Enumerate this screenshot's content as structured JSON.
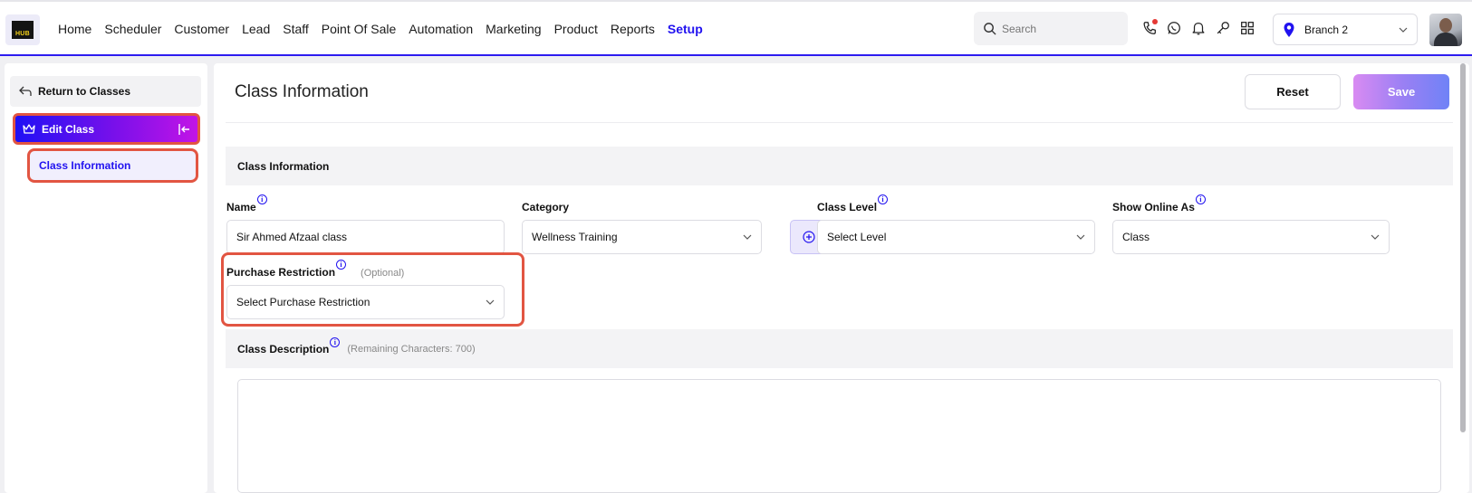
{
  "logo": {
    "text": "HUB"
  },
  "nav": {
    "items": [
      "Home",
      "Scheduler",
      "Customer",
      "Lead",
      "Staff",
      "Point Of Sale",
      "Automation",
      "Marketing",
      "Product",
      "Reports",
      "Setup"
    ],
    "active": "Setup"
  },
  "search": {
    "placeholder": "Search"
  },
  "header_icons": [
    "phone-icon",
    "whatsapp-icon",
    "bell-icon",
    "key-icon",
    "grid-icon"
  ],
  "branch": {
    "label": "Branch 2"
  },
  "sidebar": {
    "return_label": "Return to Classes",
    "section_label": "Edit Class",
    "item_label": "Class Information"
  },
  "main": {
    "title": "Class Information",
    "reset_label": "Reset",
    "save_label": "Save",
    "section_title": "Class Information",
    "fields": {
      "name": {
        "label": "Name",
        "value": "Sir Ahmed Afzaal class"
      },
      "category": {
        "label": "Category",
        "value": "Wellness Training"
      },
      "class_level": {
        "label": "Class Level",
        "value": "Select Level"
      },
      "show_online_as": {
        "label": "Show Online As",
        "value": "Class"
      },
      "purchase_restriction": {
        "label": "Purchase Restriction",
        "optional": "(Optional)",
        "value": "Select Purchase Restriction"
      }
    },
    "description": {
      "label": "Class Description",
      "remaining": "(Remaining Characters: 700)",
      "value": ""
    }
  },
  "colors": {
    "accent": "#2112f0",
    "highlight_outline": "#e25542",
    "band_bg": "#f3f3f5"
  }
}
